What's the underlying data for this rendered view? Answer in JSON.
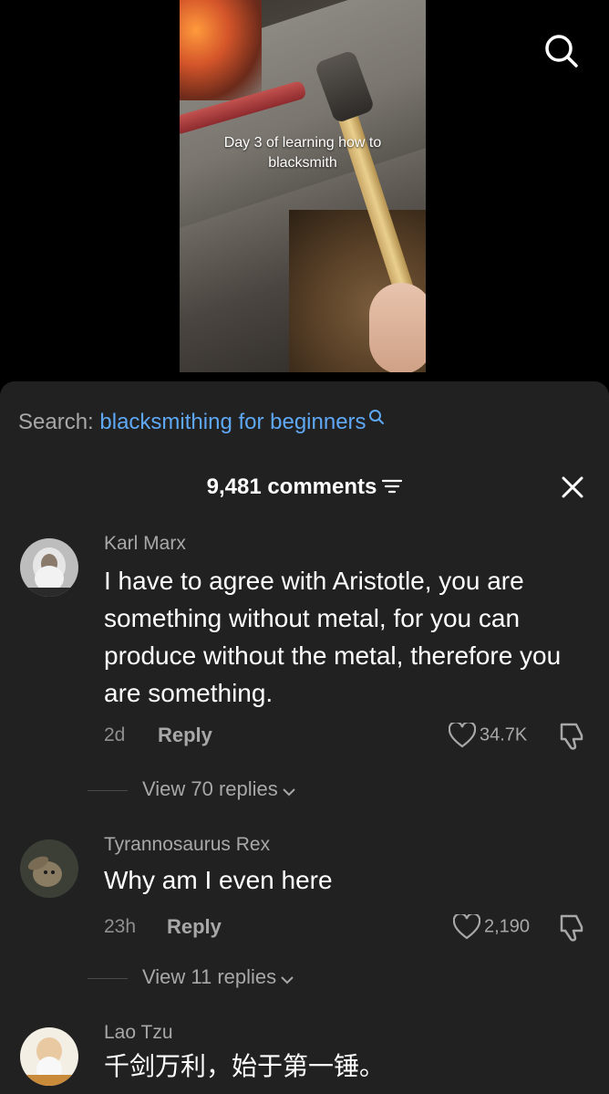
{
  "video": {
    "caption": "Day 3 of learning how to blacksmith"
  },
  "icons": {
    "search": "search-icon",
    "close": "close-icon",
    "filter": "filter-icon",
    "heart": "heart-icon",
    "dislike": "thumbs-down-icon",
    "chevron": "chevron-down-icon"
  },
  "colors": {
    "sheet_bg": "#212121",
    "link_blue": "#5fa8f5",
    "muted": "#a8a8a8"
  },
  "search_suggestion": {
    "label": "Search:",
    "query": "blacksmithing for beginners"
  },
  "comments_header": {
    "count_label": "9,481 comments"
  },
  "comments": [
    {
      "username": "Karl Marx",
      "text": "I have to agree with Aristotle, you are something without metal, for you can produce without the metal, therefore you are something.",
      "time": "2d",
      "reply_label": "Reply",
      "likes": "34.7K",
      "view_replies": "View 70 replies"
    },
    {
      "username": "Tyrannosaurus Rex",
      "text": "Why am I even here",
      "time": "23h",
      "reply_label": "Reply",
      "likes": "2,190",
      "view_replies": "View 11 replies"
    },
    {
      "username": "Lao Tzu",
      "text": "千剑万利，始于第一锤。"
    }
  ]
}
